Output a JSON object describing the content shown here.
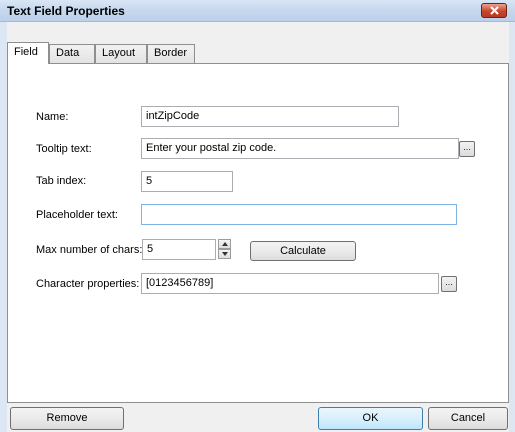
{
  "window": {
    "title": "Text Field Properties"
  },
  "tabs": [
    {
      "label": "Field",
      "active": true
    },
    {
      "label": "Data",
      "active": false
    },
    {
      "label": "Layout",
      "active": false
    },
    {
      "label": "Border",
      "active": false
    }
  ],
  "form": {
    "name_label": "Name:",
    "name_value": "intZipCode",
    "tooltip_label": "Tooltip text:",
    "tooltip_value": "Enter your postal zip code.",
    "tab_index_label": "Tab index:",
    "tab_index_value": "5",
    "placeholder_label": "Placeholder text:",
    "placeholder_value": "",
    "max_chars_label": "Max number of chars:",
    "max_chars_value": "5",
    "calculate_label": "Calculate",
    "char_props_label": "Character properties:",
    "char_props_value": "[0123456789]",
    "ellipsis": "..."
  },
  "footer": {
    "remove_label": "Remove",
    "ok_label": "OK",
    "cancel_label": "Cancel"
  },
  "icons": {
    "close": "close-icon",
    "spin_up": "arrow-up-icon",
    "spin_down": "arrow-down-icon"
  },
  "colors": {
    "close_button": "#c8452d",
    "focus_border": "#7eb4ea",
    "default_button_border": "#3c7fb1"
  }
}
